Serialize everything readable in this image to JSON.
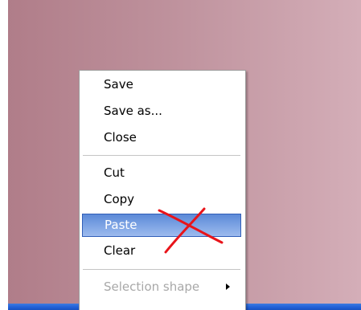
{
  "context_menu": {
    "items": [
      {
        "label": "Save",
        "state": "normal"
      },
      {
        "label": "Save as...",
        "state": "normal"
      },
      {
        "label": "Close",
        "state": "normal"
      },
      {
        "label": "Cut",
        "state": "normal"
      },
      {
        "label": "Copy",
        "state": "normal"
      },
      {
        "label": "Paste",
        "state": "highlighted"
      },
      {
        "label": "Clear",
        "state": "normal"
      },
      {
        "label": "Selection shape",
        "state": "disabled",
        "has_submenu": true
      }
    ]
  },
  "annotation": {
    "type": "cross-out",
    "color": "#e8141a"
  },
  "colors": {
    "highlight_top": "#5c8ad8",
    "highlight_bottom": "#9dbbee",
    "taskbar": "#1f5fd6",
    "disabled_text": "#a8a8a8"
  }
}
